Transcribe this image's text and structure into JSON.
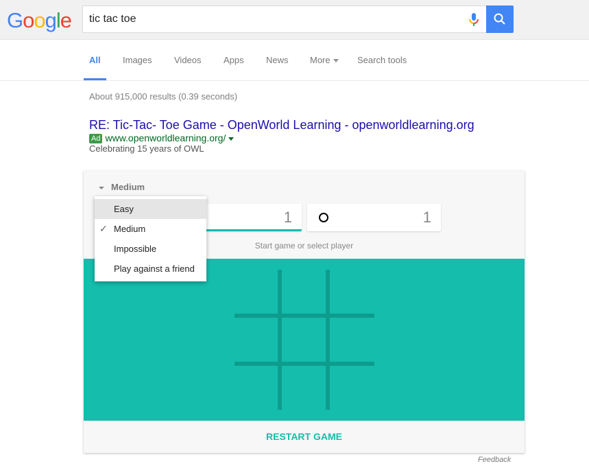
{
  "header": {
    "logo": [
      "G",
      "o",
      "o",
      "g",
      "l",
      "e"
    ],
    "logo_colors": [
      "#4285f4",
      "#ea4335",
      "#fbbc05",
      "#4285f4",
      "#34a853",
      "#ea4335"
    ],
    "search_value": "tic tac toe",
    "mic_icon": "microphone-icon",
    "search_icon": "magnifier-icon",
    "accent": "#4285f4"
  },
  "tabs": {
    "items": [
      {
        "label": "All",
        "active": true
      },
      {
        "label": "Images"
      },
      {
        "label": "Videos"
      },
      {
        "label": "Apps"
      },
      {
        "label": "News"
      },
      {
        "label": "More"
      },
      {
        "label": "Search tools"
      }
    ]
  },
  "results": {
    "stats": "About 915,000 results (0.39 seconds)"
  },
  "ad": {
    "title": "RE: Tic-Tac- Toe Game - OpenWorld Learning - openworldlearning.org",
    "badge": "Ad",
    "url": "www.openworldlearning.org/",
    "description": "Celebrating 15 years of OWL"
  },
  "game": {
    "difficulty": "Medium",
    "player_x_score": "1",
    "player_o_score": "1",
    "status": "Start game or select player",
    "restart_label": "RESTART GAME",
    "board_color": "#14bdac",
    "grid_color": "#0d9c8d",
    "dropdown": [
      {
        "label": "Easy",
        "hover": true
      },
      {
        "label": "Medium",
        "checked": true
      },
      {
        "label": "Impossible"
      },
      {
        "label": "Play against a friend"
      }
    ]
  },
  "footer": {
    "feedback": "Feedback"
  }
}
